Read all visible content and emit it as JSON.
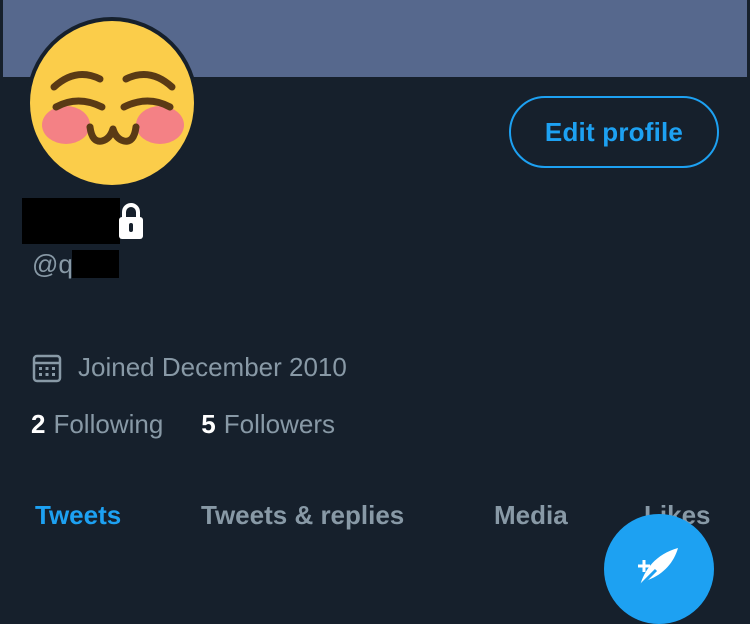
{
  "profile": {
    "handle_prefix": "@q",
    "joined": "Joined December 2010",
    "edit_label": "Edit profile"
  },
  "stats": {
    "following_count": "2",
    "following_label": "Following",
    "followers_count": "5",
    "followers_label": "Followers"
  },
  "tabs": [
    {
      "label": "Tweets",
      "active": true
    },
    {
      "label": "Tweets & replies",
      "active": false
    },
    {
      "label": "Media",
      "active": false
    },
    {
      "label": "Likes",
      "active": false
    }
  ],
  "icons": {
    "avatar": "blushing-emoji-face",
    "lock": "lock-icon",
    "calendar": "calendar-icon",
    "compose": "compose-tweet-icon"
  },
  "colors": {
    "background": "#16202c",
    "banner": "#56688d",
    "accent": "#1da1f2",
    "secondary_text": "#8899a6"
  }
}
